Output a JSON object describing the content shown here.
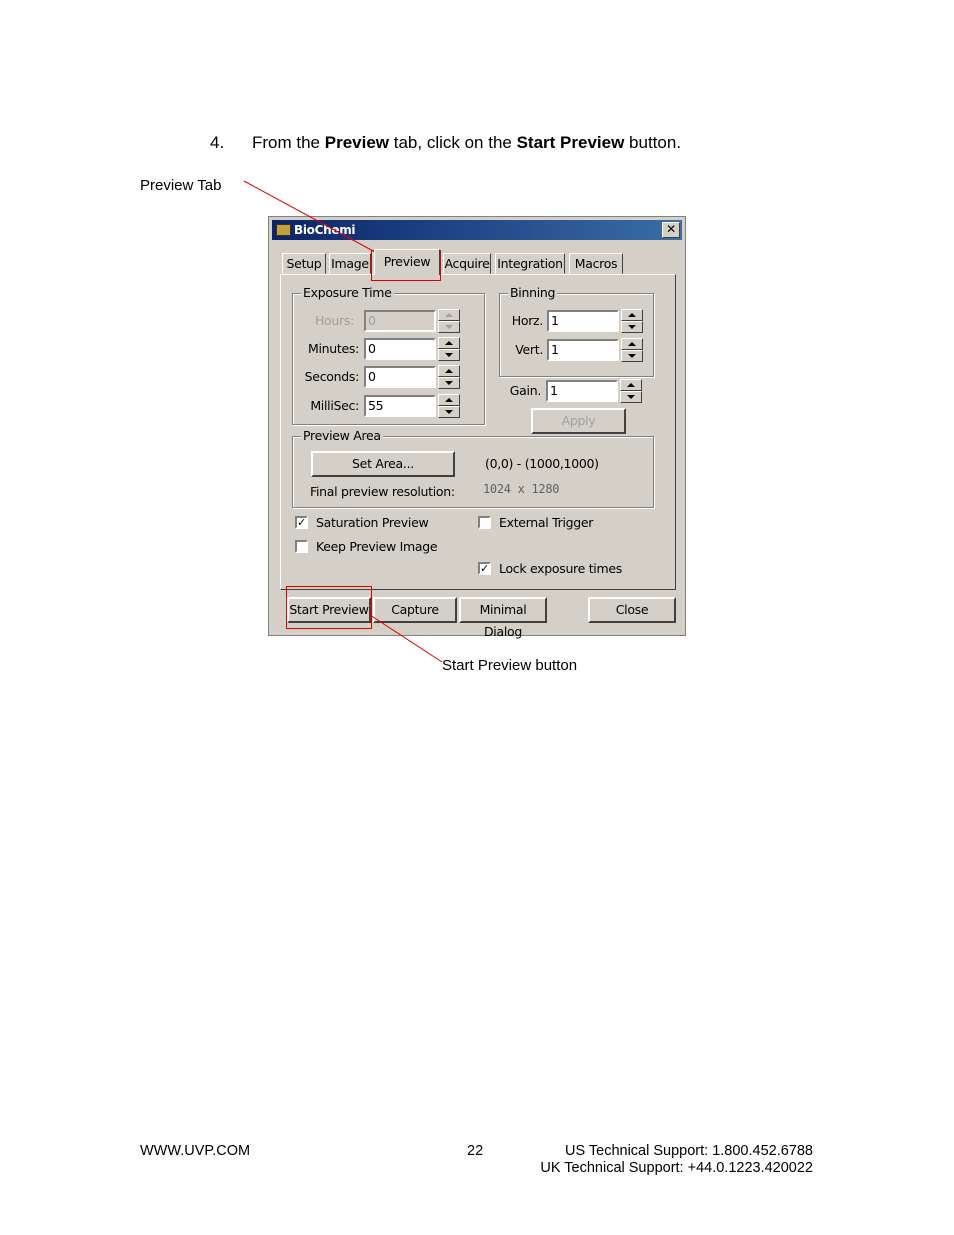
{
  "instruction": {
    "number": "4.",
    "text_1": "From the ",
    "bold_1": "Preview",
    "text_2": " tab, click on the ",
    "bold_2": "Start Preview",
    "text_3": " button."
  },
  "callouts": {
    "preview_tab": "Preview Tab",
    "start_preview_button": "Start Preview button",
    "line_color": "#e00000"
  },
  "dialog": {
    "title": "BioChemi",
    "close_glyph": "✕",
    "tabs": [
      "Setup",
      "Image",
      "Preview",
      "Acquire",
      "Integration",
      "Macros"
    ],
    "active_tab": "Preview",
    "exposure": {
      "title": "Exposure Time",
      "hours_label": "Hours:",
      "hours_value": "0",
      "minutes_label": "Minutes:",
      "minutes_value": "0",
      "seconds_label": "Seconds:",
      "seconds_value": "0",
      "millisec_label": "MilliSec:",
      "millisec_value": "55"
    },
    "binning": {
      "title": "Binning",
      "horz_label": "Horz.",
      "horz_value": "1",
      "vert_label": "Vert.",
      "vert_value": "1"
    },
    "gain_label": "Gain.",
    "gain_value": "1",
    "apply_label": "Apply",
    "preview_area": {
      "title": "Preview Area",
      "set_area_label": "Set Area...",
      "area_range": "(0,0) - (1000,1000)",
      "final_res_label": "Final preview resolution:",
      "final_res_value": "1024 x 1280"
    },
    "checkboxes": {
      "saturation_preview": "Saturation Preview",
      "keep_preview_image": "Keep Preview Image",
      "external_trigger": "External Trigger",
      "lock_exposure_times": "Lock exposure times",
      "checkmark": "✓"
    },
    "buttons": {
      "start_preview": "Start Preview",
      "capture": "Capture",
      "minimal_dialog": "Minimal Dialog",
      "close": "Close"
    }
  },
  "footer": {
    "website": "WWW.UVP.COM",
    "page_number": "22",
    "us_support": "US Technical Support: 1.800.452.6788",
    "uk_support": "UK Technical Support:  +44.0.1223.420022"
  }
}
